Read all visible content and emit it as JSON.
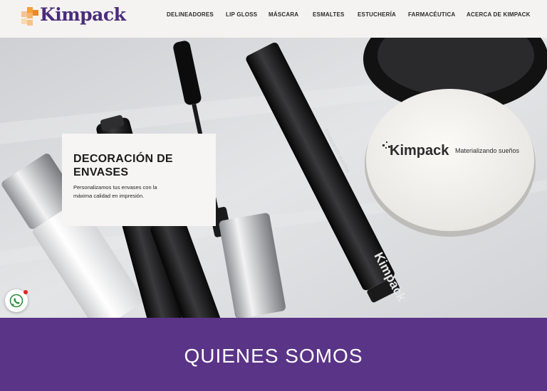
{
  "brand": {
    "name": "Kimpack",
    "color": "#4a2c7a",
    "accent": "#f4a034"
  },
  "nav": {
    "items": [
      {
        "label": "DELINEADORES"
      },
      {
        "label": "LIP GLOSS"
      },
      {
        "label": "MÁSCARA"
      },
      {
        "label": "ESMALTES"
      },
      {
        "label": "ESTUCHERÍA"
      },
      {
        "label": "FARMACÉUTICA"
      },
      {
        "label": "ACERCA DE KIMPACK"
      }
    ]
  },
  "hero": {
    "title": "DECORACIÓN DE ENVASES",
    "description": "Personalizamos tus envases con la máxima calidad en impresión.",
    "compact_brand": "Kimpack",
    "compact_tagline": "Materializando sueños",
    "mascara_brand": "Kimpack",
    "mascara_tagline": "Envasando sueños"
  },
  "whatsapp": {
    "icon": "whatsapp-icon",
    "badge_color": "#e02424"
  },
  "section": {
    "title": "QUIENES SOMOS",
    "background": "#5a3487"
  }
}
